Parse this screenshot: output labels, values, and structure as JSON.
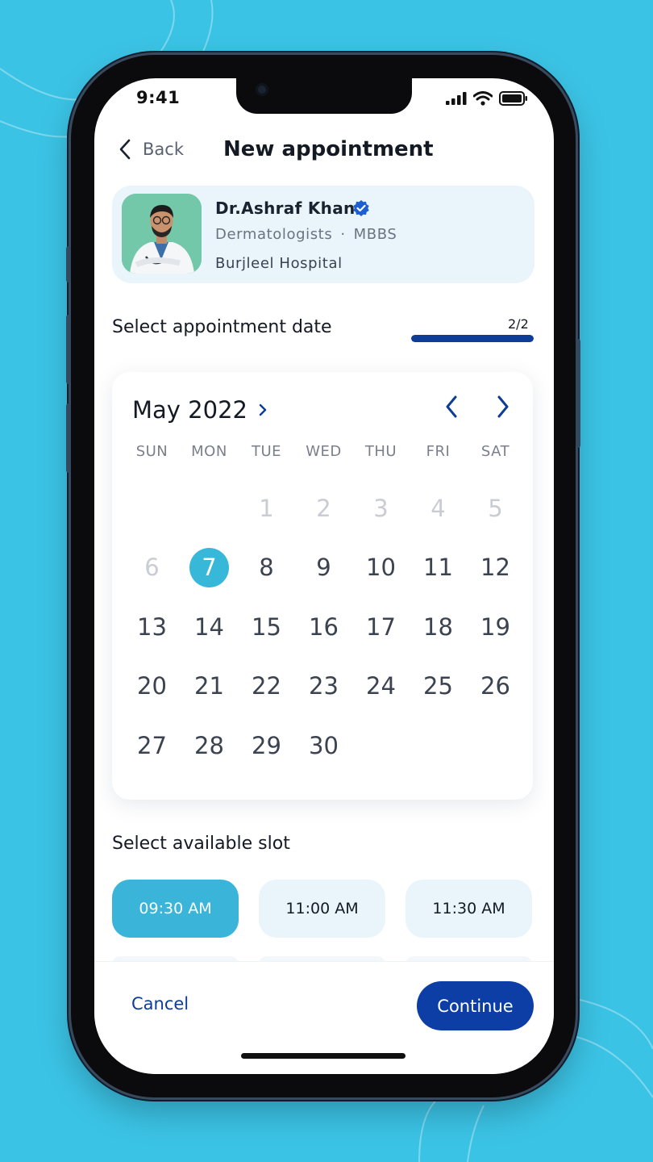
{
  "status": {
    "time": "9:41"
  },
  "header": {
    "back_label": "Back",
    "title": "New appointment"
  },
  "doctor": {
    "name": "Dr.Ashraf Khan",
    "specialty": "Dermatologists",
    "separator": "·",
    "degree": "MBBS",
    "hospital": "Burjleel Hospital"
  },
  "date_section": {
    "label": "Select appointment date",
    "step_text": "2/2",
    "step_progress": 1.0
  },
  "calendar": {
    "month_label": "May 2022",
    "weekdays": [
      "SUN",
      "MON",
      "TUE",
      "WED",
      "THU",
      "FRI",
      "SAT"
    ],
    "leading_blanks": 2,
    "muted_days": [
      "1",
      "2",
      "3",
      "4",
      "5",
      "6"
    ],
    "days": [
      "1",
      "2",
      "3",
      "4",
      "5",
      "6",
      "7",
      "8",
      "9",
      "10",
      "11",
      "12",
      "13",
      "14",
      "15",
      "16",
      "17",
      "18",
      "19",
      "20",
      "21",
      "22",
      "23",
      "24",
      "25",
      "26",
      "27",
      "28",
      "29",
      "30"
    ],
    "selected_day": "7"
  },
  "slot_section": {
    "label": "Select available slot",
    "slots": [
      {
        "time": "09:30 AM",
        "selected": true
      },
      {
        "time": "11:00 AM",
        "selected": false
      },
      {
        "time": "11:30 AM",
        "selected": false
      }
    ]
  },
  "footer": {
    "cancel_label": "Cancel",
    "continue_label": "Continue"
  },
  "colors": {
    "background": "#3bc3e5",
    "primary": "#0d3ea5",
    "accent": "#37b8d9",
    "card_tint": "#eaf5fb"
  }
}
